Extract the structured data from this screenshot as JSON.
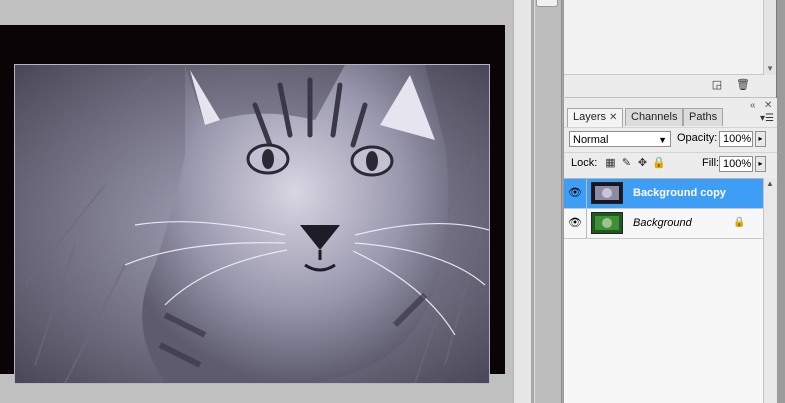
{
  "colors": {
    "canvas_bg": "#c0c0c0",
    "doc_border": "#0b0406",
    "selection_blue": "#3e9ef6",
    "panel_bg": "#ececec",
    "photo_tint": "#9a98b0"
  },
  "top_panel": {
    "new_icon": "new-layer-icon",
    "trash_icon": "trash-icon"
  },
  "layers_panel": {
    "tabs": [
      {
        "label": "Layers",
        "active": true
      },
      {
        "label": "Channels",
        "active": false
      },
      {
        "label": "Paths",
        "active": false
      }
    ],
    "blend_mode": "Normal",
    "opacity_label": "Opacity:",
    "opacity_value": "100%",
    "lock_label": "Lock:",
    "fill_label": "Fill:",
    "fill_value": "100%",
    "layers": [
      {
        "name": "Background copy",
        "visible": true,
        "selected": true,
        "locked": false
      },
      {
        "name": "Background",
        "visible": true,
        "selected": false,
        "locked": true
      }
    ]
  }
}
